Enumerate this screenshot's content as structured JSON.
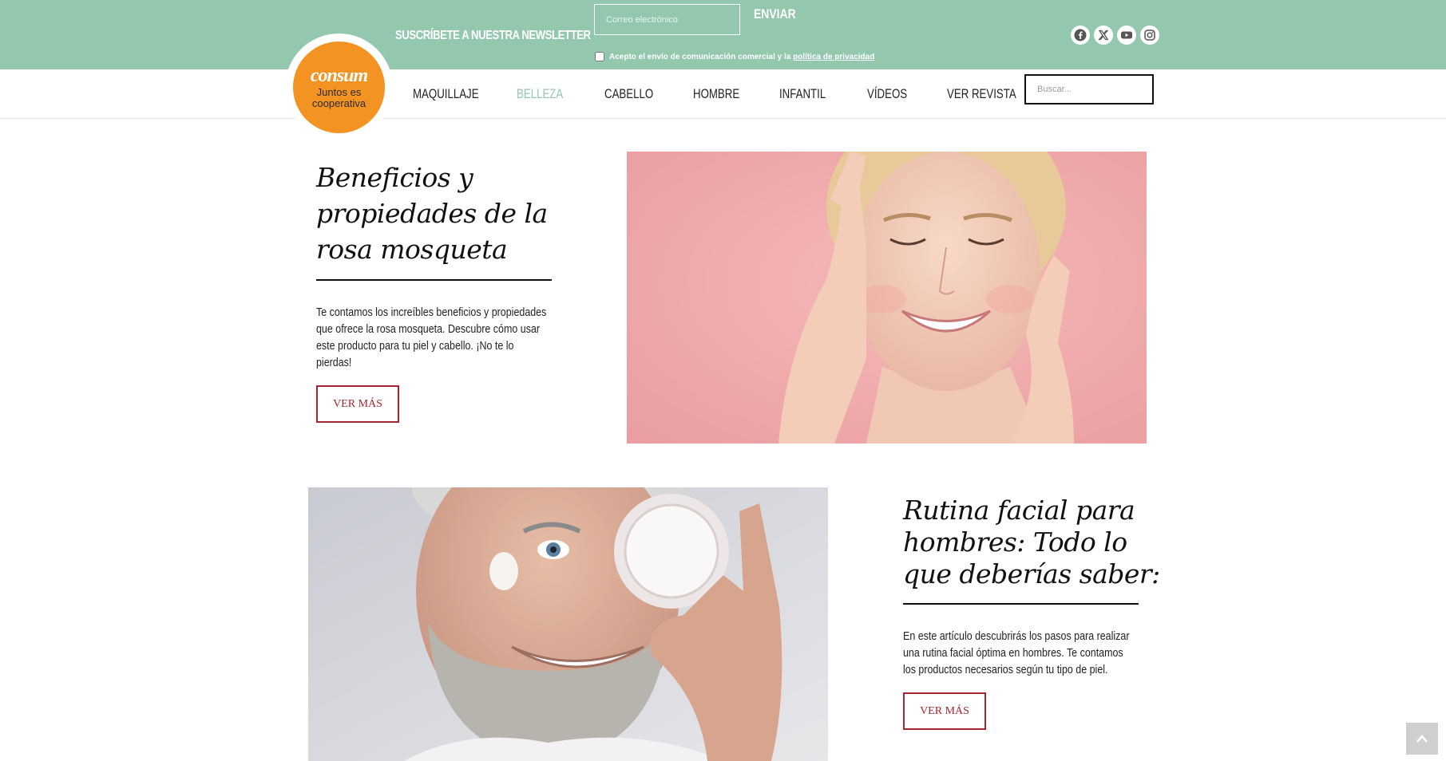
{
  "newsletter": {
    "title": "Suscríbete a nuestra newsletter",
    "email_placeholder": "Correo electrónico",
    "send_label": "ENVIAR",
    "consent_text": "Acepto el envío de comunicación comercial y la ",
    "privacy_link": "política de privacidad"
  },
  "socials": [
    "facebook-icon",
    "x-icon",
    "youtube-icon",
    "instagram-icon"
  ],
  "logo": {
    "brand": "consum",
    "tagline_1": "Juntos es",
    "tagline_2": "cooperativa"
  },
  "nav": {
    "items": [
      {
        "label": "MAQUILLAJE"
      },
      {
        "label": "BELLEZA",
        "active": true
      },
      {
        "label": "CABELLO"
      },
      {
        "label": "HOMBRE"
      },
      {
        "label": "INFANTIL"
      },
      {
        "label": "VÍDEOS"
      },
      {
        "label": "VER REVISTA"
      }
    ],
    "search_placeholder": "Buscar..."
  },
  "articles": [
    {
      "title_1": "Beneficios y",
      "title_2": "propiedades de la",
      "title_3": "rosa mosqueta",
      "excerpt_1": "Te contamos los increíbles beneficios y propiedades",
      "excerpt_2": "que ofrece la rosa mosqueta. Descubre cómo usar",
      "excerpt_3": "este producto para tu piel y cabello. ¡No te lo",
      "excerpt_4": "pierdas!",
      "button": "VER MÁS"
    },
    {
      "title_1": "Rutina facial para",
      "title_2": "hombres: Todo lo",
      "title_3": "que deberías saber:",
      "excerpt_1": "En este artículo descubrirás los pasos para realizar",
      "excerpt_2": "una rutina facial óptima en hombres. Te contamos",
      "excerpt_3": "los productos necesarios según tu tipo de piel.",
      "button": "VER MÁS"
    }
  ],
  "colors": {
    "band": "#93c8af",
    "accent_red": "#a5262f",
    "logo_orange": "#f39322"
  },
  "back_to_top_icon": "chevron-up-icon"
}
